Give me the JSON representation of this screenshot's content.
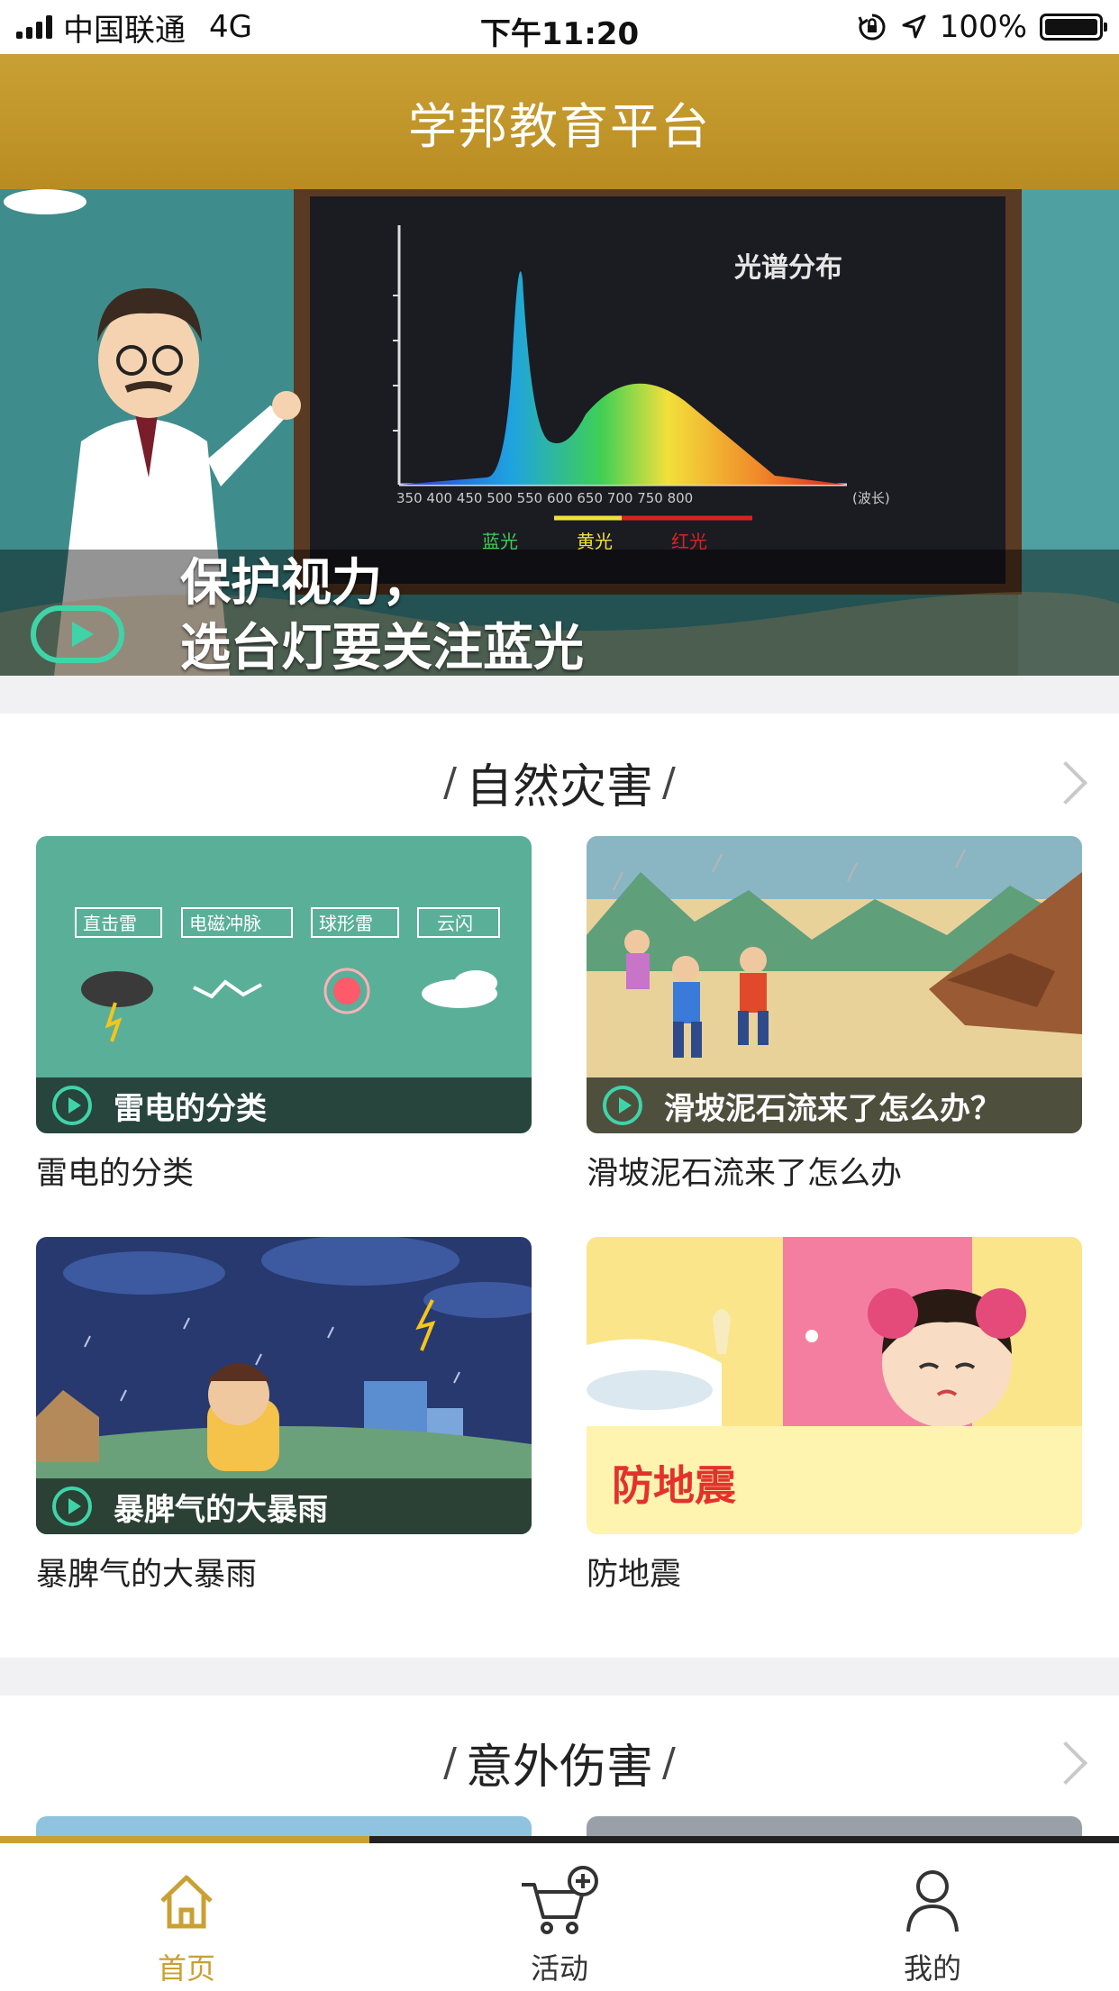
{
  "status_bar": {
    "carrier": "中国联通",
    "network": "4G",
    "time": "下午11:20",
    "battery": "100%",
    "battery_level": 1.0,
    "icons": [
      "orientation-lock-icon",
      "location-arrow-icon"
    ]
  },
  "app_bar": {
    "title": "学邦教育平台"
  },
  "banner": {
    "caption_line1": "保护视力，",
    "caption_line2": "选台灯要关注蓝光",
    "chart_title": "光谱分布"
  },
  "sections": [
    {
      "title": "自然灾害",
      "cards": [
        {
          "overlay": "雷电的分类",
          "title": "雷电的分类",
          "labels": [
            "直击雷",
            "电磁冲脉",
            "球形雷",
            "云闪"
          ]
        },
        {
          "overlay": "滑坡泥石流来了怎么办？",
          "title": "滑坡泥石流来了怎么办"
        },
        {
          "overlay": "暴脾气的大暴雨",
          "title": "暴脾气的大暴雨"
        },
        {
          "overlay": "防地震",
          "title": "防地震"
        }
      ]
    },
    {
      "title": "意外伤害"
    }
  ],
  "tab_bar": {
    "progress": 0.33,
    "active_color": "#c9a033",
    "tabs": [
      {
        "label": "首页",
        "icon": "home-icon",
        "active": true
      },
      {
        "label": "活动",
        "icon": "cart-add-icon",
        "active": false
      },
      {
        "label": "我的",
        "icon": "user-icon",
        "active": false
      }
    ]
  }
}
